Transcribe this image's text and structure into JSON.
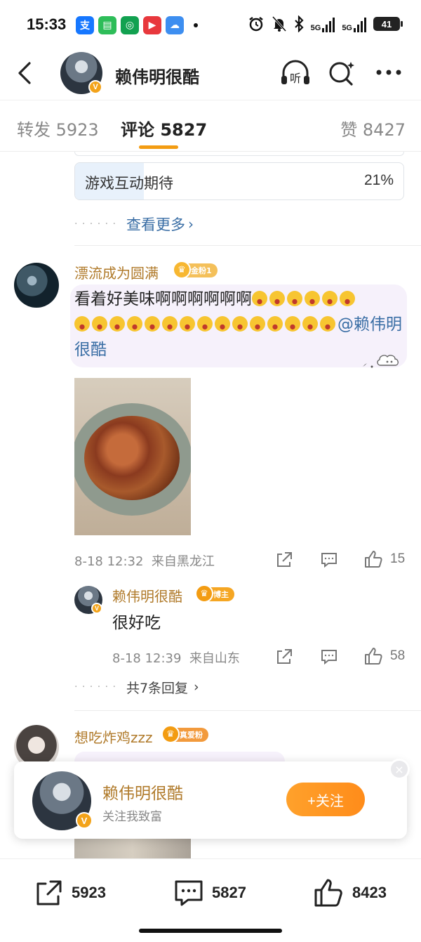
{
  "status_bar": {
    "time": "15:33",
    "apps": [
      {
        "name": "alipay-icon",
        "glyph": "支",
        "color": "#1677ff"
      },
      {
        "name": "message-icon",
        "glyph": "▤",
        "color": "#2ebd59"
      },
      {
        "name": "mobile-icon",
        "glyph": "◎",
        "color": "#12a150"
      },
      {
        "name": "tv-icon",
        "glyph": "▶",
        "color": "#e8383d"
      },
      {
        "name": "weather-icon",
        "glyph": "☁",
        "color": "#3d8ef0"
      }
    ],
    "signal_1": "5G",
    "signal_2": "5G",
    "battery": "41"
  },
  "nav": {
    "title": "赖伟明很酷",
    "listen_label": "听",
    "verified": "V"
  },
  "tabs": {
    "repost": "转发 5923",
    "comment": "评论 5827",
    "like": "赞 8427"
  },
  "poll": {
    "option_label": "游戏互动期待",
    "option_pct": "21%",
    "fill_fraction": 0.21,
    "see_more": "查看更多",
    "chevron": "›"
  },
  "comment1": {
    "user": "漂流成为圆满",
    "badge": "金粉1",
    "text_a": "看着好美味啊啊啊啊啊啊",
    "mention": "@赖伟明很酷",
    "emoji_count_line1": 6,
    "emoji_count_line2": 15,
    "time": "8-18 12:32",
    "location": "来自黑龙江",
    "likes": "15"
  },
  "reply": {
    "user": "赖伟明很酷",
    "badge": "博主",
    "text": "很好吃",
    "time": "8-18 12:39",
    "location": "来自山东",
    "likes": "58"
  },
  "more_replies": {
    "label": "共7条回复",
    "chevron": "›"
  },
  "comment2": {
    "user": "想吃炸鸡zzz",
    "badge": "真爱粉"
  },
  "follow_card": {
    "name": "赖伟明很酷",
    "subtitle": "关注我致富",
    "follow_label": "+关注",
    "close": "×"
  },
  "bottom_bar": {
    "repost": "5923",
    "comment": "5827",
    "like": "8423"
  }
}
